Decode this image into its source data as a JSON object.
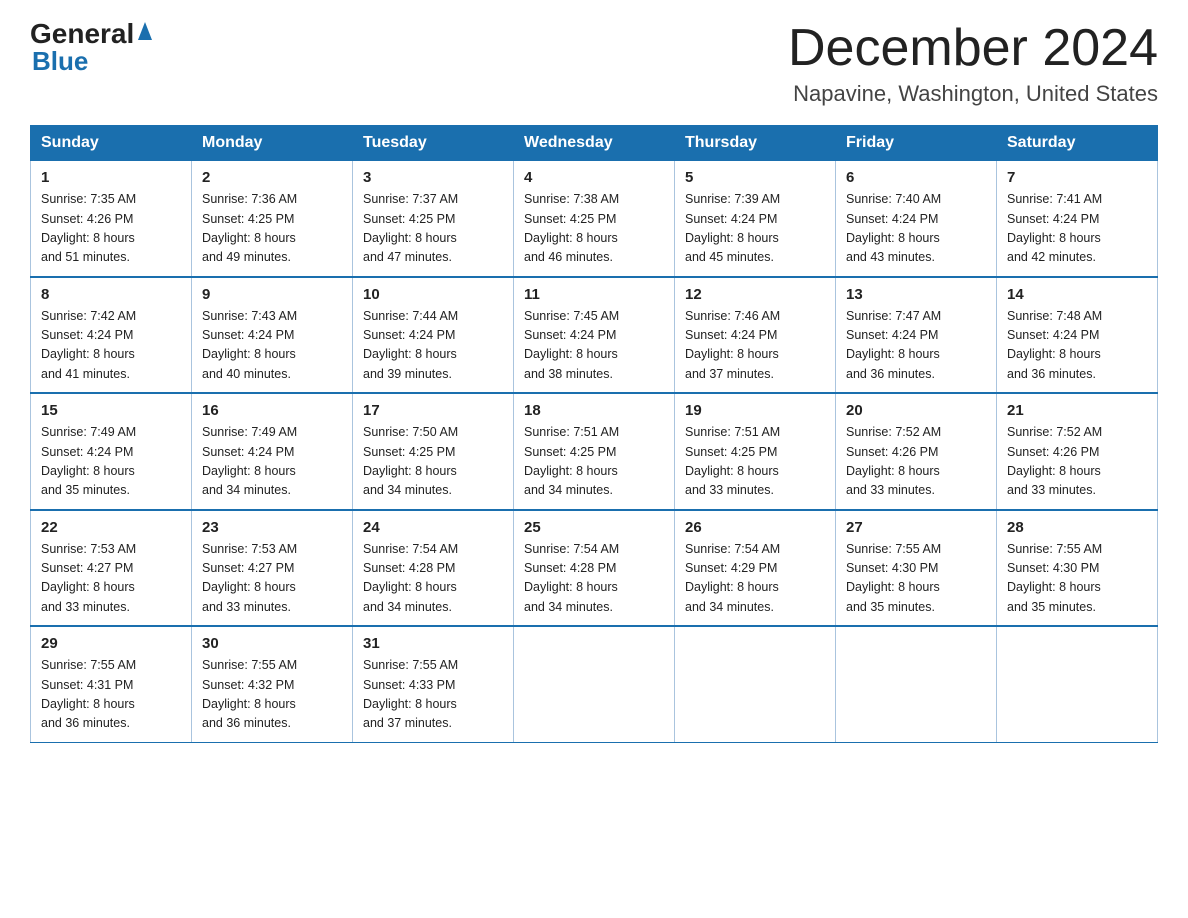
{
  "header": {
    "logo_general": "General",
    "logo_blue": "Blue",
    "month_title": "December 2024",
    "location": "Napavine, Washington, United States"
  },
  "days_of_week": [
    "Sunday",
    "Monday",
    "Tuesday",
    "Wednesday",
    "Thursday",
    "Friday",
    "Saturday"
  ],
  "weeks": [
    [
      {
        "day": "1",
        "sunrise": "7:35 AM",
        "sunset": "4:26 PM",
        "daylight": "8 hours and 51 minutes."
      },
      {
        "day": "2",
        "sunrise": "7:36 AM",
        "sunset": "4:25 PM",
        "daylight": "8 hours and 49 minutes."
      },
      {
        "day": "3",
        "sunrise": "7:37 AM",
        "sunset": "4:25 PM",
        "daylight": "8 hours and 47 minutes."
      },
      {
        "day": "4",
        "sunrise": "7:38 AM",
        "sunset": "4:25 PM",
        "daylight": "8 hours and 46 minutes."
      },
      {
        "day": "5",
        "sunrise": "7:39 AM",
        "sunset": "4:24 PM",
        "daylight": "8 hours and 45 minutes."
      },
      {
        "day": "6",
        "sunrise": "7:40 AM",
        "sunset": "4:24 PM",
        "daylight": "8 hours and 43 minutes."
      },
      {
        "day": "7",
        "sunrise": "7:41 AM",
        "sunset": "4:24 PM",
        "daylight": "8 hours and 42 minutes."
      }
    ],
    [
      {
        "day": "8",
        "sunrise": "7:42 AM",
        "sunset": "4:24 PM",
        "daylight": "8 hours and 41 minutes."
      },
      {
        "day": "9",
        "sunrise": "7:43 AM",
        "sunset": "4:24 PM",
        "daylight": "8 hours and 40 minutes."
      },
      {
        "day": "10",
        "sunrise": "7:44 AM",
        "sunset": "4:24 PM",
        "daylight": "8 hours and 39 minutes."
      },
      {
        "day": "11",
        "sunrise": "7:45 AM",
        "sunset": "4:24 PM",
        "daylight": "8 hours and 38 minutes."
      },
      {
        "day": "12",
        "sunrise": "7:46 AM",
        "sunset": "4:24 PM",
        "daylight": "8 hours and 37 minutes."
      },
      {
        "day": "13",
        "sunrise": "7:47 AM",
        "sunset": "4:24 PM",
        "daylight": "8 hours and 36 minutes."
      },
      {
        "day": "14",
        "sunrise": "7:48 AM",
        "sunset": "4:24 PM",
        "daylight": "8 hours and 36 minutes."
      }
    ],
    [
      {
        "day": "15",
        "sunrise": "7:49 AM",
        "sunset": "4:24 PM",
        "daylight": "8 hours and 35 minutes."
      },
      {
        "day": "16",
        "sunrise": "7:49 AM",
        "sunset": "4:24 PM",
        "daylight": "8 hours and 34 minutes."
      },
      {
        "day": "17",
        "sunrise": "7:50 AM",
        "sunset": "4:25 PM",
        "daylight": "8 hours and 34 minutes."
      },
      {
        "day": "18",
        "sunrise": "7:51 AM",
        "sunset": "4:25 PM",
        "daylight": "8 hours and 34 minutes."
      },
      {
        "day": "19",
        "sunrise": "7:51 AM",
        "sunset": "4:25 PM",
        "daylight": "8 hours and 33 minutes."
      },
      {
        "day": "20",
        "sunrise": "7:52 AM",
        "sunset": "4:26 PM",
        "daylight": "8 hours and 33 minutes."
      },
      {
        "day": "21",
        "sunrise": "7:52 AM",
        "sunset": "4:26 PM",
        "daylight": "8 hours and 33 minutes."
      }
    ],
    [
      {
        "day": "22",
        "sunrise": "7:53 AM",
        "sunset": "4:27 PM",
        "daylight": "8 hours and 33 minutes."
      },
      {
        "day": "23",
        "sunrise": "7:53 AM",
        "sunset": "4:27 PM",
        "daylight": "8 hours and 33 minutes."
      },
      {
        "day": "24",
        "sunrise": "7:54 AM",
        "sunset": "4:28 PM",
        "daylight": "8 hours and 34 minutes."
      },
      {
        "day": "25",
        "sunrise": "7:54 AM",
        "sunset": "4:28 PM",
        "daylight": "8 hours and 34 minutes."
      },
      {
        "day": "26",
        "sunrise": "7:54 AM",
        "sunset": "4:29 PM",
        "daylight": "8 hours and 34 minutes."
      },
      {
        "day": "27",
        "sunrise": "7:55 AM",
        "sunset": "4:30 PM",
        "daylight": "8 hours and 35 minutes."
      },
      {
        "day": "28",
        "sunrise": "7:55 AM",
        "sunset": "4:30 PM",
        "daylight": "8 hours and 35 minutes."
      }
    ],
    [
      {
        "day": "29",
        "sunrise": "7:55 AM",
        "sunset": "4:31 PM",
        "daylight": "8 hours and 36 minutes."
      },
      {
        "day": "30",
        "sunrise": "7:55 AM",
        "sunset": "4:32 PM",
        "daylight": "8 hours and 36 minutes."
      },
      {
        "day": "31",
        "sunrise": "7:55 AM",
        "sunset": "4:33 PM",
        "daylight": "8 hours and 37 minutes."
      },
      null,
      null,
      null,
      null
    ]
  ],
  "labels": {
    "sunrise": "Sunrise:",
    "sunset": "Sunset:",
    "daylight": "Daylight:"
  }
}
